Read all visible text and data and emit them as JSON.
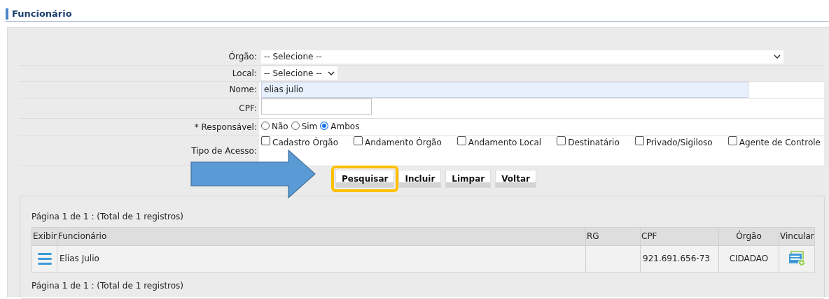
{
  "title": "Funcionário",
  "form": {
    "orgao": {
      "label": "Órgão:",
      "value": "-- Selecione --"
    },
    "local": {
      "label": "Local:",
      "value": "-- Selecione --"
    },
    "nome": {
      "label": "Nome:",
      "value": "elias julio"
    },
    "cpf": {
      "label": "CPF:"
    },
    "responsavel": {
      "label": "* Responsável:",
      "options": [
        {
          "label": "Não",
          "selected": false
        },
        {
          "label": "Sim",
          "selected": false
        },
        {
          "label": "Ambos",
          "selected": true
        }
      ]
    },
    "tipo_acesso": {
      "label": "Tipo de Acesso:",
      "options": [
        {
          "label": "Cadastro Órgão",
          "checked": false
        },
        {
          "label": "Andamento Órgão",
          "checked": false
        },
        {
          "label": "Andamento Local",
          "checked": false
        },
        {
          "label": "Destinatário",
          "checked": false
        },
        {
          "label": "Privado/Sigiloso",
          "checked": false
        },
        {
          "label": "Agente de Controle",
          "checked": false
        }
      ]
    }
  },
  "buttons": [
    {
      "label": "Pesquisar",
      "highlighted": true
    },
    {
      "label": "Incluir",
      "highlighted": false
    },
    {
      "label": "Limpar",
      "highlighted": false
    },
    {
      "label": "Voltar",
      "highlighted": false
    }
  ],
  "pointer_arrow": true,
  "results": {
    "pager_top": "Página 1 de 1 : (Total de 1 registros)",
    "columns": [
      "Exibir",
      "Funcionário",
      "RG",
      "CPF",
      "Órgão",
      "Vincular"
    ],
    "rows": [
      {
        "funcionario": "Elias Julio",
        "rg": "",
        "cpf": "921.691.656-73",
        "orgao": "CIDADAO"
      }
    ],
    "pager_bottom": "Página 1 de 1 : (Total de 1 registros)"
  }
}
